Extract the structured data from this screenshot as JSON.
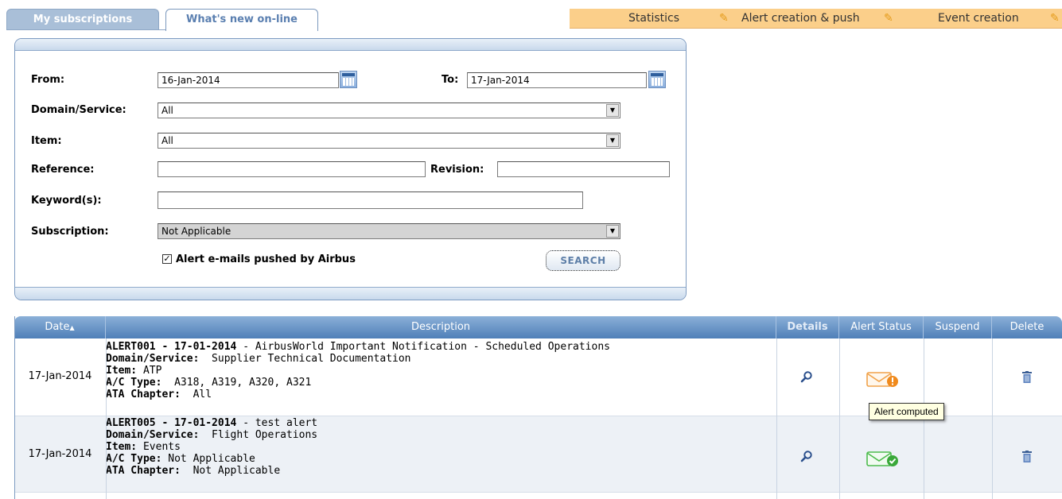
{
  "tabs": {
    "inactive": "My subscriptions",
    "active": "What's new on-line"
  },
  "topbar": {
    "statistics": "Statistics",
    "alert_creation": "Alert creation & push",
    "event_creation": "Event creation"
  },
  "form": {
    "from_label": "From:",
    "from_value": "16-Jan-2014",
    "to_label": "To:",
    "to_value": "17-Jan-2014",
    "domain_label": "Domain/Service:",
    "domain_value": "All",
    "item_label": "Item:",
    "item_value": "All",
    "reference_label": "Reference:",
    "reference_value": "",
    "revision_label": "Revision:",
    "revision_value": "",
    "keyword_label": "Keyword(s):",
    "keyword_value": "",
    "subscription_label": "Subscription:",
    "subscription_value": "Not Applicable",
    "checkbox_label": "Alert e-mails pushed by Airbus",
    "checkbox_checked": true,
    "search_label": "SEARCH"
  },
  "grid": {
    "headers": {
      "date": "Date",
      "description": "Description",
      "details": "Details",
      "alert_status": "Alert Status",
      "suspend": "Suspend",
      "delete": "Delete"
    },
    "rows": [
      {
        "date": "17-Jan-2014",
        "title_id": "ALERT001 - 17-01-2014",
        "title_text": " - AirbusWorld Important Notification - Scheduled Operations",
        "domain_label": "Domain/Service:",
        "domain": "  Supplier Technical Documentation",
        "item_label": "Item:",
        "item": " ATP",
        "ac_label": "A/C Type:",
        "ac": "  A318, A319, A320, A321",
        "ata_label": "ATA Chapter:",
        "ata": "  All",
        "status": "computed"
      },
      {
        "date": "17-Jan-2014",
        "title_id": "ALERT005 - 17-01-2014",
        "title_text": " - test alert",
        "domain_label": "Domain/Service:",
        "domain": "  Flight Operations",
        "item_label": "Item:",
        "item": " Events",
        "ac_label": "A/C Type:",
        "ac": " Not Applicable",
        "ata_label": "ATA Chapter:",
        "ata": "  Not Applicable",
        "status": "pushed"
      }
    ]
  },
  "tooltip": "Alert computed",
  "colors": {
    "header_blue": "#4f7fb8",
    "topbar_orange": "#fbcf8a",
    "status_warning": "#f08a1c",
    "status_ok": "#3aa83a"
  }
}
